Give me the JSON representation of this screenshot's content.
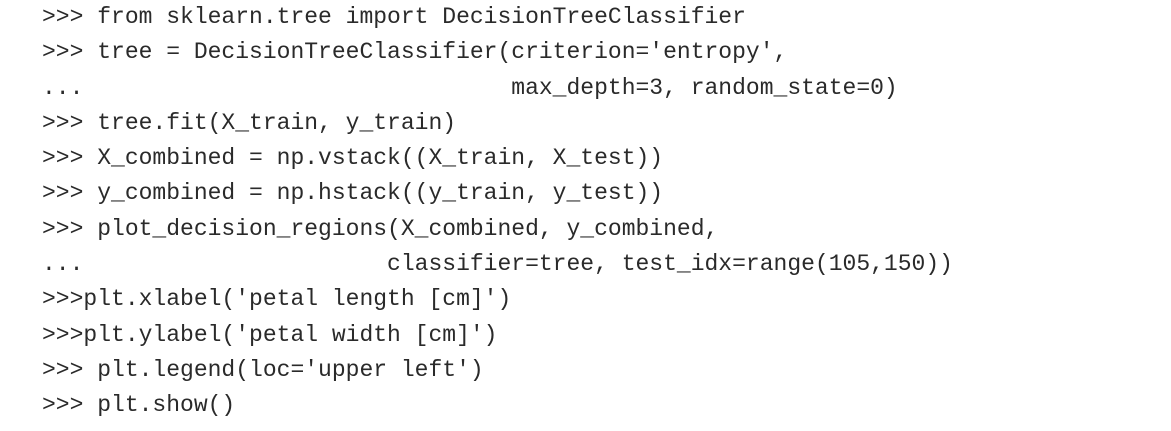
{
  "code": {
    "lines": [
      ">>> from sklearn.tree import DecisionTreeClassifier",
      ">>> tree = DecisionTreeClassifier(criterion='entropy',",
      "...                               max_depth=3, random_state=0)",
      ">>> tree.fit(X_train, y_train)",
      ">>> X_combined = np.vstack((X_train, X_test))",
      ">>> y_combined = np.hstack((y_train, y_test))",
      ">>> plot_decision_regions(X_combined, y_combined,",
      "...                      classifier=tree, test_idx=range(105,150))",
      ">>>plt.xlabel('petal length [cm]')",
      ">>>plt.ylabel('petal width [cm]')",
      ">>> plt.legend(loc='upper left')",
      ">>> plt.show()"
    ]
  }
}
